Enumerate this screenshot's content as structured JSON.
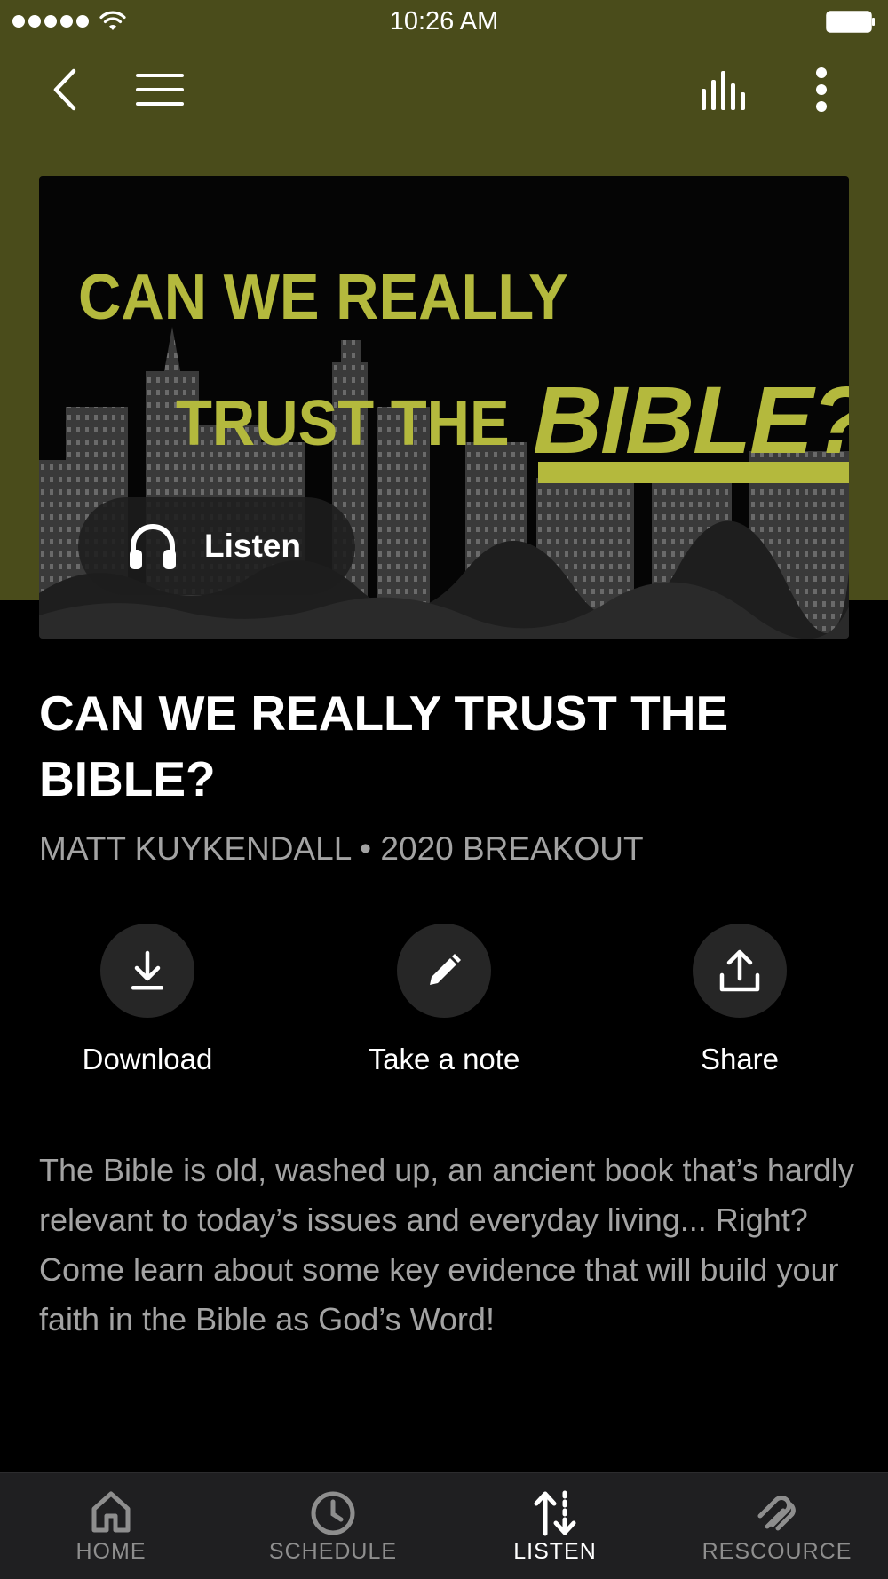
{
  "status_bar": {
    "time": "10:26 AM",
    "signal_icon": "signal-dots-icon",
    "wifi_icon": "wifi-icon",
    "battery_icon": "battery-icon"
  },
  "nav": {
    "back_icon": "chevron-left-icon",
    "menu_icon": "hamburger-menu-icon",
    "now_playing_icon": "equalizer-icon",
    "more_icon": "vertical-ellipsis-icon"
  },
  "hero": {
    "line1": "CAN WE REALLY",
    "line2": "TRUST THE",
    "emphasis": "BIBLE?",
    "listen_label": "Listen",
    "listen_icon": "headphones-icon"
  },
  "sermon": {
    "title": "CAN WE REALLY TRUST THE BIBLE?",
    "speaker_series": "MATT KUYKENDALL • 2020 BREAKOUT",
    "description": "The Bible is old, washed up, an ancient book that’s hardly relevant to today’s issues and everyday living... Right? Come learn about some key evidence that will build your faith in the Bible as God’s Word!"
  },
  "actions": [
    {
      "label": "Download",
      "icon": "download-icon"
    },
    {
      "label": "Take a note",
      "icon": "pencil-icon"
    },
    {
      "label": "Share",
      "icon": "share-icon"
    }
  ],
  "tabs": [
    {
      "label": "HOME",
      "icon": "home-icon",
      "active": false
    },
    {
      "label": "SCHEDULE",
      "icon": "clock-icon",
      "active": false
    },
    {
      "label": "LISTEN",
      "icon": "listen-arrows-icon",
      "active": true
    },
    {
      "label": "RESCOURCE",
      "icon": "resource-icon",
      "active": false
    }
  ],
  "colors": {
    "header": "#4a4c1b",
    "accent": "#b4b93d",
    "background": "#000000",
    "tab_bar": "#1f1f21",
    "muted_text": "#a3a3a3"
  }
}
